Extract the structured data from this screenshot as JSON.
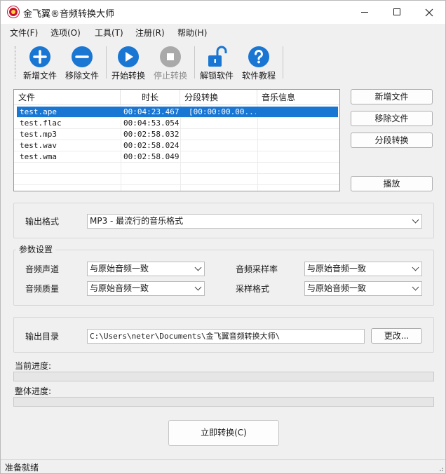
{
  "window": {
    "title": "金飞翼®音频转换大师"
  },
  "menu": [
    {
      "label": "文件(F)"
    },
    {
      "label": "选项(O)"
    },
    {
      "label": "工具(T)"
    },
    {
      "label": "注册(R)"
    },
    {
      "label": "帮助(H)"
    }
  ],
  "toolbar": {
    "add_file": "新增文件",
    "remove_file": "移除文件",
    "start": "开始转换",
    "stop": "停止转换",
    "unlock": "解锁软件",
    "tutorial": "软件教程"
  },
  "file_list": {
    "columns": [
      "文件",
      "时长",
      "分段转换",
      "音乐信息"
    ],
    "rows": [
      {
        "file": "test.ape",
        "duration": "00:04:23.467",
        "segment": "[00:00:00.00...",
        "info": ""
      },
      {
        "file": "test.flac",
        "duration": "00:04:53.054",
        "segment": "",
        "info": ""
      },
      {
        "file": "test.mp3",
        "duration": "00:02:58.032",
        "segment": "",
        "info": ""
      },
      {
        "file": "test.wav",
        "duration": "00:02:58.024",
        "segment": "",
        "info": ""
      },
      {
        "file": "test.wma",
        "duration": "00:02:58.049",
        "segment": "",
        "info": ""
      }
    ]
  },
  "side_buttons": {
    "add_file": "新增文件",
    "remove_file": "移除文件",
    "segment": "分段转换",
    "play": "播放"
  },
  "output_format": {
    "label": "输出格式",
    "value": "MP3 - 最流行的音乐格式"
  },
  "params": {
    "title": "参数设置",
    "channel_label": "音频声道",
    "channel_value": "与原始音频一致",
    "samplerate_label": "音频采样率",
    "samplerate_value": "与原始音频一致",
    "quality_label": "音频质量",
    "quality_value": "与原始音频一致",
    "sampleformat_label": "采样格式",
    "sampleformat_value": "与原始音频一致"
  },
  "output_dir": {
    "label": "输出目录",
    "value": "C:\\Users\\neter\\Documents\\金飞翼音频转换大师\\",
    "change": "更改..."
  },
  "progress": {
    "current_label": "当前进度:",
    "current_value": 0,
    "overall_label": "整体进度:",
    "overall_value": 0
  },
  "convert_button": "立即转换(C)",
  "status": "准备就绪",
  "colors": {
    "icon_blue": "#1976d2",
    "icon_gray": "#a9a9a9",
    "selection": "#1976d2"
  }
}
